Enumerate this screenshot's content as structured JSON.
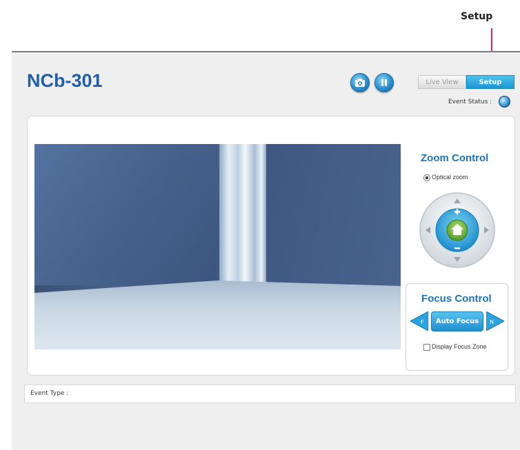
{
  "annotation": {
    "label": "Setup",
    "line_color": "#c8227a"
  },
  "header": {
    "title": "NCb-301",
    "buttons": [
      {
        "name": "snapshot",
        "icon": "camera-icon"
      },
      {
        "name": "pause",
        "icon": "pause-icon"
      }
    ],
    "tabs": [
      {
        "label": "Live View",
        "active": false
      },
      {
        "label": "Setup",
        "active": true
      }
    ],
    "event_status_label": "Event Status :"
  },
  "zoom": {
    "title": "Zoom Control",
    "option_label": "Optical zoom",
    "dial_icons": [
      "arrow-up-icon",
      "arrow-down-icon",
      "arrow-left-icon",
      "arrow-right-icon",
      "zoom-in-icon",
      "zoom-out-icon",
      "home-icon"
    ]
  },
  "focus": {
    "title": "Focus Control",
    "far_label": "F",
    "near_label": "N",
    "auto_label": "Auto Focus",
    "display_zone_label": "Display Focus Zone"
  },
  "event": {
    "type_label": "Event Type :"
  },
  "colors": {
    "brand": "#1f5ea8",
    "accent": "#1b96d4",
    "page_bg": "#efefef"
  }
}
